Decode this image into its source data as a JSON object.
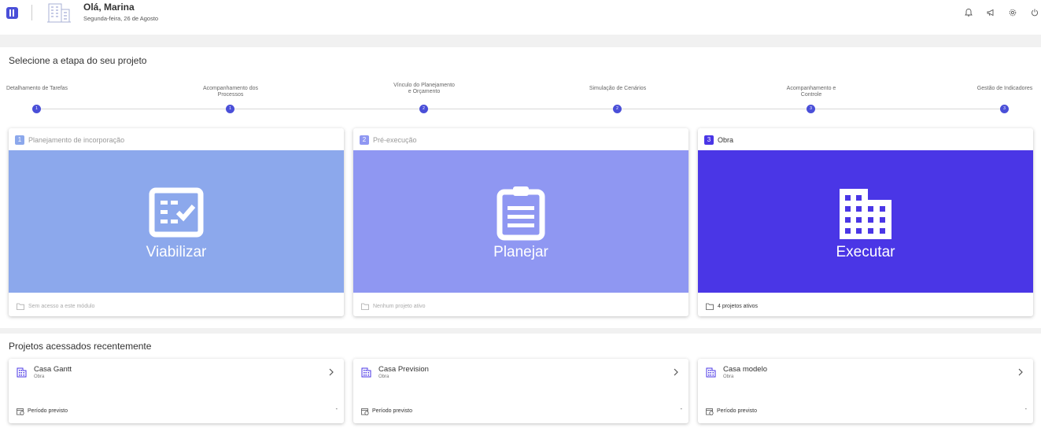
{
  "header": {
    "greeting": "Olá, Marina",
    "date": "Segunda-feira, 26 de Agosto",
    "icons": [
      "bell-icon",
      "megaphone-icon",
      "gear-icon",
      "power-icon"
    ]
  },
  "stages_section": {
    "title": "Selecione a etapa do seu projeto",
    "steps": [
      {
        "label": "Detalhamento de Tarefas",
        "number": "1"
      },
      {
        "label": "Acompanhamento dos Processos",
        "number": "1"
      },
      {
        "label": "Vínculo do Planejamento e Orçamento",
        "number": "2"
      },
      {
        "label": "Simulação de Cenários",
        "number": "2"
      },
      {
        "label": "Acompanhamento e Controle",
        "number": "3"
      },
      {
        "label": "Gestão de Indicadores",
        "number": "3"
      }
    ],
    "cards": [
      {
        "number": "1",
        "title": "Planejamento de incorporação",
        "action": "Viabilizar",
        "status": "Sem acesso a este módulo",
        "icon": "checklist-icon",
        "color": "#8ca8ec",
        "badge_color": "#8ca8ec"
      },
      {
        "number": "2",
        "title": "Pré-execução",
        "action": "Planejar",
        "status": "Nenhum projeto ativo",
        "icon": "clipboard-icon",
        "color": "#8f97f2",
        "badge_color": "#8f97f2"
      },
      {
        "number": "3",
        "title": "Obra",
        "action": "Executar",
        "status": "4 projetos ativos",
        "icon": "building-icon",
        "color": "#4a36e6",
        "badge_color": "#4a36e6"
      }
    ]
  },
  "recent_section": {
    "title": "Projetos acessados recentemente",
    "projects": [
      {
        "name": "Casa Gantt",
        "type": "Obra",
        "period_label": "Período previsto",
        "period_value": "-"
      },
      {
        "name": "Casa Prevision",
        "type": "Obra",
        "period_label": "Período previsto",
        "period_value": "-"
      },
      {
        "name": "Casa modelo",
        "type": "Obra",
        "period_label": "Período previsto",
        "period_value": "-"
      }
    ]
  }
}
